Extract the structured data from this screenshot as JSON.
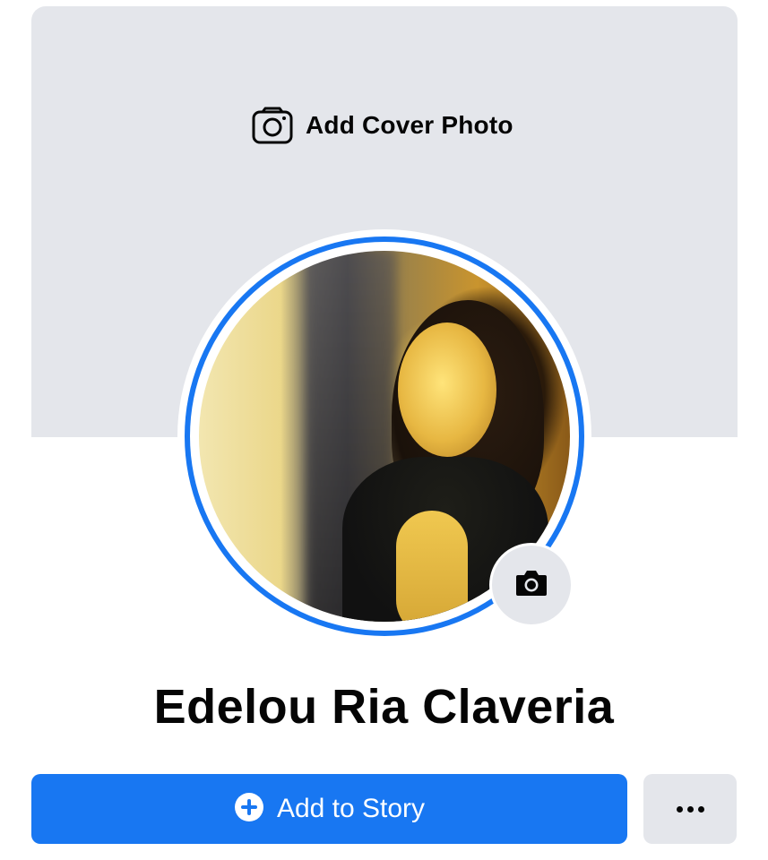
{
  "cover": {
    "action_label": "Add Cover Photo",
    "action_icon": "camera-icon",
    "background_color": "#e4e6eb"
  },
  "avatar": {
    "ring_color": "#1877f2",
    "edit_icon": "camera-icon"
  },
  "profile": {
    "name": "Edelou Ria Claveria"
  },
  "actions": {
    "add_story_label": "Add to Story",
    "add_story_icon": "plus-circle-icon",
    "add_story_color": "#1877f2",
    "more_icon": "more-dots-icon"
  }
}
